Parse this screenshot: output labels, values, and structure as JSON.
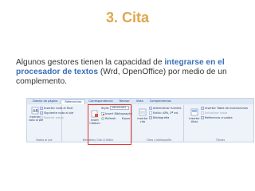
{
  "slide": {
    "title": "3. Cita",
    "text_before": "Algunos gestores tienen la capacidad de ",
    "text_highlight": "integrarse en el procesador de textos",
    "text_after": " (Wrd, OpenOffice) por medio de un complemento."
  },
  "ribbon": {
    "tabs": [
      "Diseño de página",
      "Referencias",
      "Correspondencia",
      "Revisar",
      "Vista",
      "Complementos"
    ],
    "active_tab_index": 1,
    "groups": {
      "notes": {
        "label": "Notas al pie",
        "big_button": "Insertar\nnota al pie",
        "items": [
          "Insertar nota al final",
          "Siguiente nota al pie",
          "Mostrar notas"
        ]
      },
      "mendeley": {
        "label": "Mendeley Cite-O-Matic",
        "big_button": "Insert\nCitation",
        "style_label": "Style:",
        "style_value": "Vancouver",
        "items": [
          "Insert Bibliography",
          "Refresh"
        ],
        "export_label": "Expor"
      },
      "citations": {
        "label": "Citas y bibliografía",
        "big_button": "Insertar\ncita",
        "items": [
          "Administrar fuentes",
          "Estilo: APA, 5ª ed.",
          "Bibliografía"
        ]
      },
      "captions": {
        "label": "Títulos",
        "big_button": "Insertar\ntítulo",
        "items": [
          "Insertar Tabla de ilustraciones",
          "Actualizar tabla",
          "Referencia cruzada"
        ]
      }
    }
  },
  "colors": {
    "title": "#e0a64a",
    "highlight_text": "#3a6fb7",
    "annotation_box": "#e23a2e"
  }
}
